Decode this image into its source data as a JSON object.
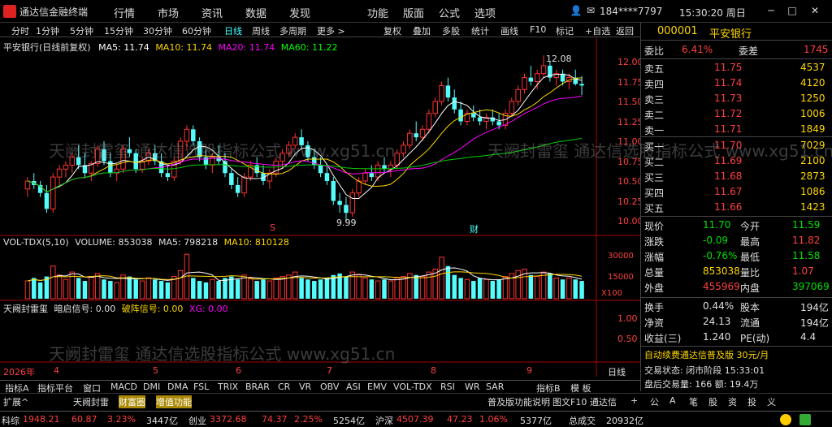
{
  "titlebar": {
    "app_title": "通达信金融终端",
    "menus": [
      "行情",
      "市场",
      "资讯",
      "数据",
      "发现",
      "功能",
      "版面",
      "公式",
      "选项"
    ],
    "account": "184****7797",
    "time": "15:30:20 周日"
  },
  "toolbar": {
    "periods": [
      "分时",
      "1分钟",
      "5分钟",
      "15分钟",
      "30分钟",
      "60分钟",
      "日线",
      "周线",
      "多周期",
      "更多 >"
    ],
    "selected_period": "日线",
    "tools": [
      "复权",
      "叠加",
      "多股",
      "统计",
      "画线",
      "F10",
      "标记",
      "+自选",
      "返回"
    ]
  },
  "main_chart": {
    "label": "平安银行(日线前复权)",
    "ma5_label": "MA5: 11.74",
    "ma10_label": "MA10: 11.74",
    "ma20_label": "MA20: 11.74",
    "ma60_label": "MA60: 11.22",
    "high_label": "12.08",
    "low_label": "9.99",
    "marker_s": "S",
    "marker_cai": "财",
    "yaxis": [
      "12.00",
      "11.75",
      "11.50",
      "11.25",
      "11.00",
      "10.75",
      "10.50",
      "10.25",
      "10.00"
    ]
  },
  "volume_chart": {
    "label": "VOL-TDX(5,10)",
    "volume_label": "VOLUME: 853038",
    "ma5_label": "MA5: 798218",
    "ma10_label": "MA10: 810128",
    "yaxis": [
      "30000",
      "15000",
      "X100"
    ]
  },
  "signal_chart": {
    "label": "天阙封雷玺",
    "signal1": "暗启信号: 0.00",
    "signal2": "破阵信号: 0.00",
    "signal3": "XG: 0.00",
    "yaxis": [
      "1.00",
      "0.50"
    ]
  },
  "xaxis": {
    "year": "2026年",
    "months": [
      "4",
      "5",
      "6",
      "7",
      "8",
      "9"
    ],
    "label": "日线"
  },
  "indicator_tabs": [
    "指标A",
    "指标平台",
    "窗口",
    "MACD",
    "DMI",
    "DMA",
    "FSL",
    "TRIX",
    "BRAR",
    "CR",
    "VR",
    "OBV",
    "ASI",
    "EMV",
    "VOL-TDX",
    "RSI",
    "WR",
    "SAR",
    "指标B",
    "模 板"
  ],
  "ext_bar": {
    "items": [
      "扩展^",
      "天阙封雷",
      "财富圈",
      "增值功能"
    ],
    "right": [
      "普及版功能说明",
      "图文F10",
      "通达信",
      "+",
      "公",
      "A",
      "笔",
      "股",
      "资",
      "投",
      "义"
    ]
  },
  "quote": {
    "code": "000001",
    "name": "平安银行",
    "weibi_label": "委比",
    "weibi": "6.41%",
    "weicha_label": "委差",
    "weicha": "1745",
    "asks": [
      {
        "label": "卖五",
        "price": "11.75",
        "vol": "4537"
      },
      {
        "label": "卖四",
        "price": "11.74",
        "vol": "4120"
      },
      {
        "label": "卖三",
        "price": "11.73",
        "vol": "1250"
      },
      {
        "label": "卖二",
        "price": "11.72",
        "vol": "1006"
      },
      {
        "label": "卖一",
        "price": "11.71",
        "vol": "1849"
      }
    ],
    "bids": [
      {
        "label": "买一",
        "price": "11.70",
        "vol": "7029"
      },
      {
        "label": "买二",
        "price": "11.69",
        "vol": "2100"
      },
      {
        "label": "买三",
        "price": "11.68",
        "vol": "2873"
      },
      {
        "label": "买四",
        "price": "11.67",
        "vol": "1086"
      },
      {
        "label": "买五",
        "price": "11.66",
        "vol": "1423"
      }
    ],
    "stats": [
      {
        "l1": "现价",
        "v1": "11.70",
        "l2": "今开",
        "v2": "11.59",
        "c1": "grn",
        "c2": "grn"
      },
      {
        "l1": "涨跌",
        "v1": "-0.09",
        "l2": "最高",
        "v2": "11.82",
        "c1": "grn",
        "c2": "red"
      },
      {
        "l1": "涨幅",
        "v1": "-0.76%",
        "l2": "最低",
        "v2": "11.58",
        "c1": "grn",
        "c2": "grn"
      },
      {
        "l1": "总量",
        "v1": "853038",
        "l2": "量比",
        "v2": "1.07",
        "c1": "yel",
        "c2": "red"
      },
      {
        "l1": "外盘",
        "v1": "455969",
        "l2": "内盘",
        "v2": "397069",
        "c1": "red",
        "c2": "grn"
      }
    ],
    "stats2": [
      {
        "l1": "换手",
        "v1": "0.44%",
        "l2": "股本",
        "v2": "194亿"
      },
      {
        "l1": "净资",
        "v1": "24.13",
        "l2": "流通",
        "v2": "194亿"
      },
      {
        "l1": "收益(三)",
        "v1": "1.240",
        "l2": "PE(动)",
        "v2": "4.4"
      }
    ],
    "promo": "自动续费通达信普及版 30元/月",
    "trade_status": "交易状态: 闭市阶段 15:33:01",
    "after_hours": "盘后交易量: 166 额: 19.4万"
  },
  "statusbar": [
    {
      "name": "科综",
      "val": "1948.21",
      "chg": "60.87",
      "pct": "3.23%",
      "amt": "3447亿"
    },
    {
      "name": "创业",
      "val": "3372.68",
      "chg": "74.37",
      "pct": "2.25%",
      "amt": "5254亿"
    },
    {
      "name": "沪深",
      "val": "4507.39",
      "chg": "47.23",
      "pct": "1.06%",
      "amt": "5377亿"
    },
    {
      "name": "总成交",
      "val": "",
      "chg": "",
      "pct": "",
      "amt": "20932亿"
    }
  ],
  "watermark": "天阙封雷玺 通达信选股指标公式 www.xg51.cn",
  "chart_data": {
    "type": "candlestick",
    "ylim": [
      9.9,
      12.15
    ],
    "candles": [
      [
        10.4,
        10.55,
        10.3,
        10.5
      ],
      [
        10.5,
        10.6,
        10.4,
        10.45
      ],
      [
        10.45,
        10.5,
        10.3,
        10.35
      ],
      [
        10.35,
        10.45,
        10.1,
        10.15
      ],
      [
        10.15,
        10.6,
        10.1,
        10.55
      ],
      [
        10.55,
        10.7,
        10.45,
        10.65
      ],
      [
        10.65,
        10.75,
        10.55,
        10.7
      ],
      [
        10.7,
        10.85,
        10.6,
        10.8
      ],
      [
        10.8,
        10.95,
        10.65,
        10.7
      ],
      [
        10.7,
        10.85,
        10.55,
        10.6
      ],
      [
        10.6,
        10.75,
        10.5,
        10.72
      ],
      [
        10.72,
        10.95,
        10.68,
        10.9
      ],
      [
        10.9,
        11.0,
        10.7,
        10.75
      ],
      [
        10.75,
        10.85,
        10.55,
        10.6
      ],
      [
        10.6,
        10.7,
        10.5,
        10.65
      ],
      [
        10.65,
        10.95,
        10.6,
        10.9
      ],
      [
        10.9,
        11.05,
        10.8,
        10.85
      ],
      [
        10.85,
        10.9,
        10.6,
        10.65
      ],
      [
        10.65,
        10.8,
        10.6,
        10.75
      ],
      [
        10.75,
        10.9,
        10.7,
        10.85
      ],
      [
        10.85,
        10.95,
        10.7,
        10.75
      ],
      [
        10.75,
        10.85,
        10.55,
        10.6
      ],
      [
        10.6,
        10.7,
        10.5,
        10.55
      ],
      [
        10.55,
        10.8,
        10.5,
        10.75
      ],
      [
        10.75,
        11.05,
        10.7,
        11.0
      ],
      [
        11.0,
        11.2,
        10.9,
        11.15
      ],
      [
        11.15,
        11.2,
        10.95,
        11.0
      ],
      [
        11.0,
        11.05,
        10.75,
        10.8
      ],
      [
        10.8,
        10.9,
        10.65,
        10.7
      ],
      [
        10.7,
        10.85,
        10.6,
        10.8
      ],
      [
        10.8,
        10.95,
        10.7,
        10.75
      ],
      [
        10.75,
        10.85,
        10.55,
        10.6
      ],
      [
        10.6,
        10.65,
        10.4,
        10.45
      ],
      [
        10.45,
        10.55,
        10.3,
        10.35
      ],
      [
        10.35,
        10.6,
        10.3,
        10.55
      ],
      [
        10.55,
        10.75,
        10.5,
        10.7
      ],
      [
        10.7,
        10.8,
        10.55,
        10.6
      ],
      [
        10.6,
        10.7,
        10.45,
        10.5
      ],
      [
        10.5,
        10.65,
        10.4,
        10.6
      ],
      [
        10.6,
        10.8,
        10.55,
        10.75
      ],
      [
        10.75,
        10.9,
        10.65,
        10.85
      ],
      [
        10.85,
        11.0,
        10.8,
        10.95
      ],
      [
        10.95,
        11.1,
        10.9,
        11.05
      ],
      [
        11.05,
        11.15,
        10.9,
        10.95
      ],
      [
        10.95,
        11.0,
        10.75,
        10.8
      ],
      [
        10.8,
        10.9,
        10.65,
        10.7
      ],
      [
        10.7,
        10.8,
        10.55,
        10.6
      ],
      [
        10.6,
        10.7,
        10.45,
        10.5
      ],
      [
        10.5,
        10.55,
        10.2,
        10.25
      ],
      [
        10.25,
        10.35,
        10.1,
        10.2
      ],
      [
        10.2,
        10.3,
        9.99,
        10.1
      ],
      [
        10.1,
        10.4,
        10.05,
        10.35
      ],
      [
        10.35,
        10.55,
        10.3,
        10.5
      ],
      [
        10.5,
        10.65,
        10.45,
        10.6
      ],
      [
        10.6,
        10.7,
        10.5,
        10.55
      ],
      [
        10.55,
        10.75,
        10.5,
        10.7
      ],
      [
        10.7,
        10.8,
        10.6,
        10.65
      ],
      [
        10.65,
        10.75,
        10.55,
        10.7
      ],
      [
        10.7,
        10.9,
        10.65,
        10.85
      ],
      [
        10.85,
        11.0,
        10.8,
        10.95
      ],
      [
        10.95,
        11.15,
        10.9,
        11.1
      ],
      [
        11.1,
        11.25,
        11.0,
        11.05
      ],
      [
        11.05,
        11.2,
        11.0,
        11.15
      ],
      [
        11.15,
        11.4,
        11.1,
        11.35
      ],
      [
        11.35,
        11.55,
        11.3,
        11.5
      ],
      [
        11.5,
        11.75,
        11.45,
        11.7
      ],
      [
        11.7,
        11.8,
        11.5,
        11.55
      ],
      [
        11.55,
        11.65,
        11.35,
        11.4
      ],
      [
        11.4,
        11.5,
        11.2,
        11.25
      ],
      [
        11.25,
        11.4,
        11.2,
        11.35
      ],
      [
        11.35,
        11.45,
        11.25,
        11.3
      ],
      [
        11.3,
        11.4,
        11.2,
        11.25
      ],
      [
        11.25,
        11.35,
        11.15,
        11.3
      ],
      [
        11.3,
        11.4,
        11.2,
        11.25
      ],
      [
        11.25,
        11.35,
        11.15,
        11.2
      ],
      [
        11.2,
        11.4,
        11.15,
        11.35
      ],
      [
        11.35,
        11.55,
        11.3,
        11.5
      ],
      [
        11.5,
        11.7,
        11.45,
        11.65
      ],
      [
        11.65,
        11.85,
        11.6,
        11.8
      ],
      [
        11.8,
        11.95,
        11.7,
        11.75
      ],
      [
        11.75,
        11.9,
        11.65,
        11.85
      ],
      [
        11.85,
        12.08,
        11.8,
        11.95
      ],
      [
        11.95,
        12.0,
        11.75,
        11.8
      ],
      [
        11.8,
        11.9,
        11.7,
        11.85
      ],
      [
        11.85,
        11.9,
        11.7,
        11.75
      ],
      [
        11.75,
        11.85,
        11.65,
        11.8
      ],
      [
        11.8,
        11.9,
        11.7,
        11.72
      ],
      [
        11.72,
        11.82,
        11.58,
        11.7
      ]
    ],
    "volumes": [
      12,
      14,
      11,
      15,
      22,
      16,
      13,
      18,
      14,
      12,
      15,
      17,
      13,
      12,
      11,
      16,
      15,
      13,
      12,
      14,
      13,
      12,
      11,
      15,
      19,
      30,
      14,
      12,
      11,
      13,
      12,
      14,
      15,
      13,
      16,
      14,
      12,
      13,
      12,
      14,
      15,
      16,
      18,
      14,
      13,
      12,
      13,
      14,
      16,
      17,
      15,
      18,
      16,
      14,
      13,
      12,
      13,
      12,
      14,
      15,
      17,
      16,
      15,
      18,
      20,
      28,
      22,
      16,
      14,
      13,
      12,
      14,
      13,
      12,
      13,
      15,
      17,
      19,
      20,
      16,
      15,
      18,
      17,
      14,
      13,
      14,
      13,
      12
    ]
  }
}
